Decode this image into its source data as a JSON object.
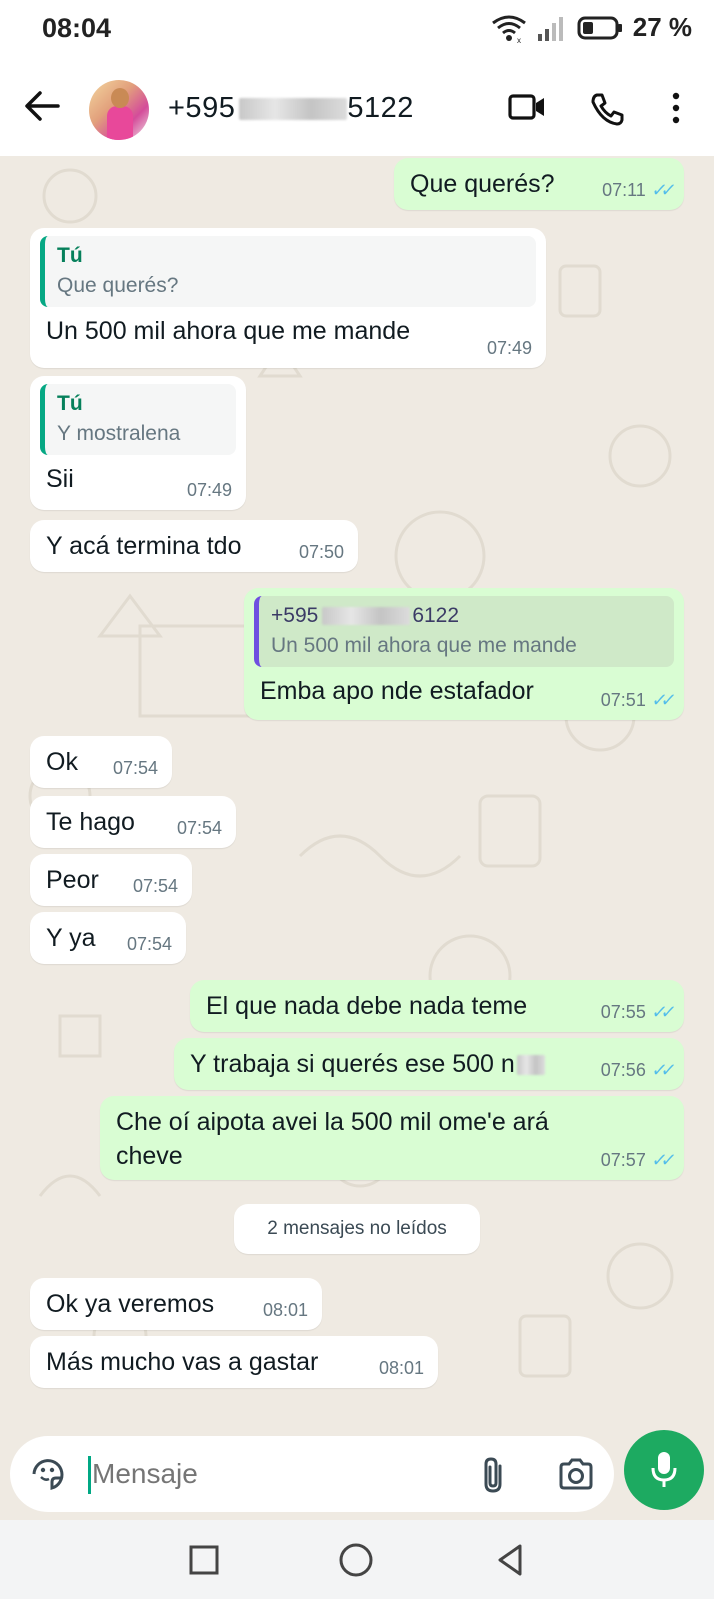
{
  "status": {
    "time": "08:04",
    "battery": "27 %"
  },
  "header": {
    "contact_prefix": "+595",
    "contact_suffix": "5122"
  },
  "messages": [
    {
      "text": "Que querés?",
      "time": "07:11"
    },
    {
      "quote_author": "Tú",
      "quote_text": "Que querés?",
      "text": "Un 500 mil ahora que me mande",
      "time": "07:49"
    },
    {
      "quote_author": "Tú",
      "quote_text": "Y mostralena",
      "text": "Sii",
      "time": "07:49"
    },
    {
      "text": "Y acá termina tdo",
      "time": "07:50"
    },
    {
      "quote_author_prefix": "+595",
      "quote_author_suffix": "6122",
      "quote_text": "Un 500 mil ahora que me mande",
      "text": "Emba apo nde estafador",
      "time": "07:51"
    },
    {
      "text": "Ok",
      "time": "07:54"
    },
    {
      "text": "Te hago",
      "time": "07:54"
    },
    {
      "text": "Peor",
      "time": "07:54"
    },
    {
      "text": "Y ya",
      "time": "07:54"
    },
    {
      "text": "El que nada debe nada teme",
      "time": "07:55"
    },
    {
      "text": "Y trabaja si querés ese 500 n",
      "time": "07:56"
    },
    {
      "text": "Che oí aipota avei la 500 mil ome'e ará cheve",
      "time": "07:57"
    },
    {
      "text": "Ok ya veremos",
      "time": "08:01"
    },
    {
      "text": "Más mucho vas a gastar",
      "time": "08:01"
    }
  ],
  "unread_label": "2 mensajes no leídos",
  "composer": {
    "placeholder": "Mensaje"
  },
  "colors": {
    "incoming": "#ffffff",
    "outgoing": "#d9fdd3",
    "accent": "#1daa61",
    "tick": "#53bdeb"
  }
}
